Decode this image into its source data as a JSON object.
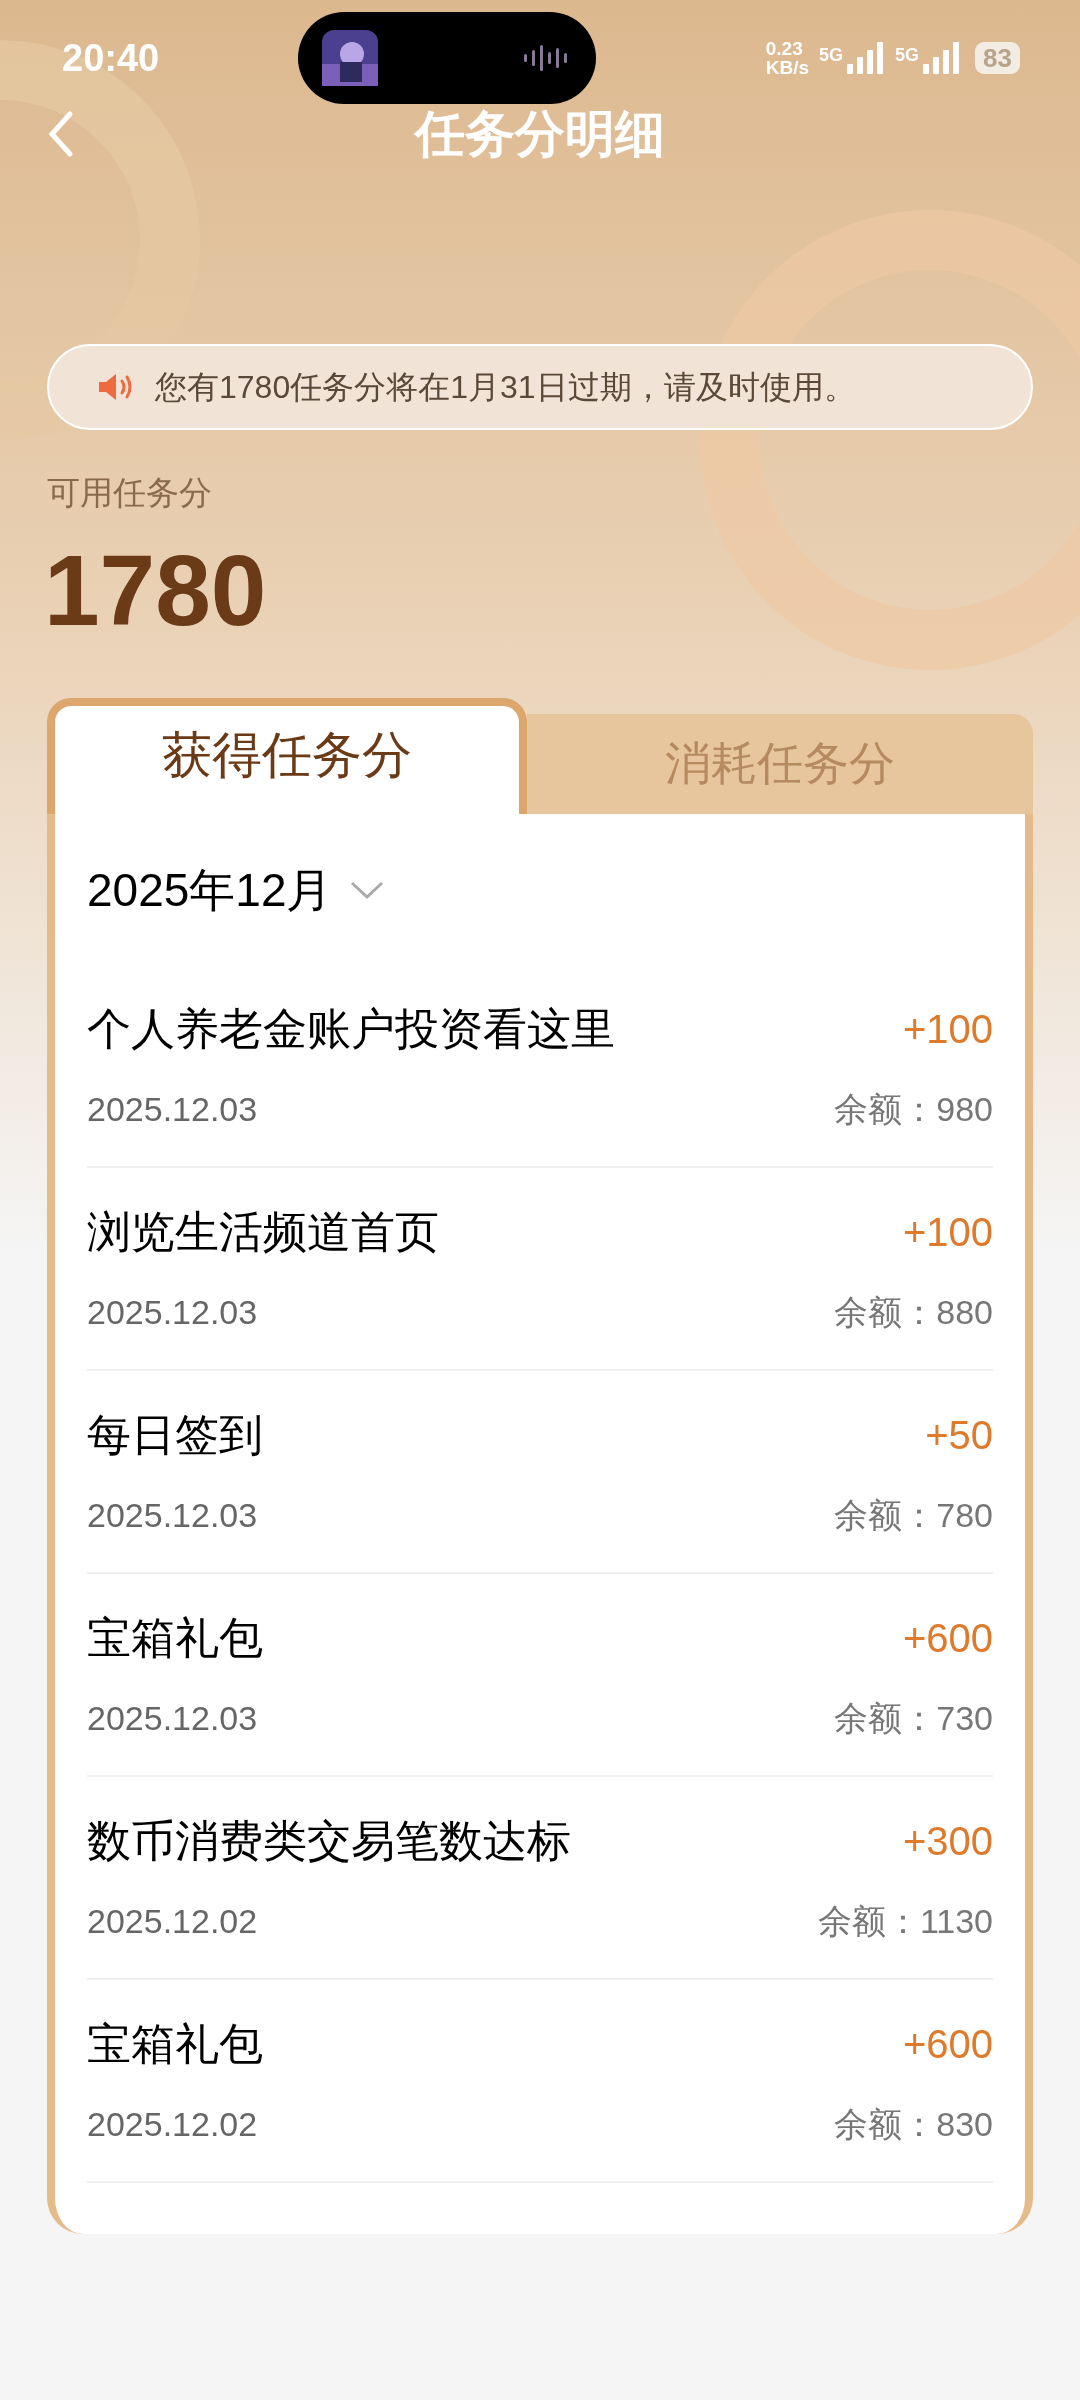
{
  "status_bar": {
    "time": "20:40",
    "speed_value": "0.23",
    "speed_unit": "KB/s",
    "sims": [
      "5G",
      "5G"
    ],
    "battery": "83"
  },
  "header": {
    "title": "任务分明细"
  },
  "notice": {
    "text": "您有1780任务分将在1月31日过期，请及时使用。"
  },
  "balance": {
    "label": "可用任务分",
    "value": "1780"
  },
  "tabs": [
    {
      "label": "获得任务分",
      "selected": true
    },
    {
      "label": "消耗任务分",
      "selected": false
    }
  ],
  "month_selector": {
    "value": "2025年12月"
  },
  "records": [
    {
      "title": "个人养老金账户投资看这里",
      "date": "2025.12.03",
      "amount": "+100",
      "balance": "余额：980"
    },
    {
      "title": "浏览生活频道首页",
      "date": "2025.12.03",
      "amount": "+100",
      "balance": "余额：880"
    },
    {
      "title": "每日签到",
      "date": "2025.12.03",
      "amount": "+50",
      "balance": "余额：780"
    },
    {
      "title": "宝箱礼包",
      "date": "2025.12.03",
      "amount": "+600",
      "balance": "余额：730"
    },
    {
      "title": "数币消费类交易笔数达标",
      "date": "2025.12.02",
      "amount": "+300",
      "balance": "余额：1130"
    },
    {
      "title": "宝箱礼包",
      "date": "2025.12.02",
      "amount": "+600",
      "balance": "余额：830"
    }
  ]
}
